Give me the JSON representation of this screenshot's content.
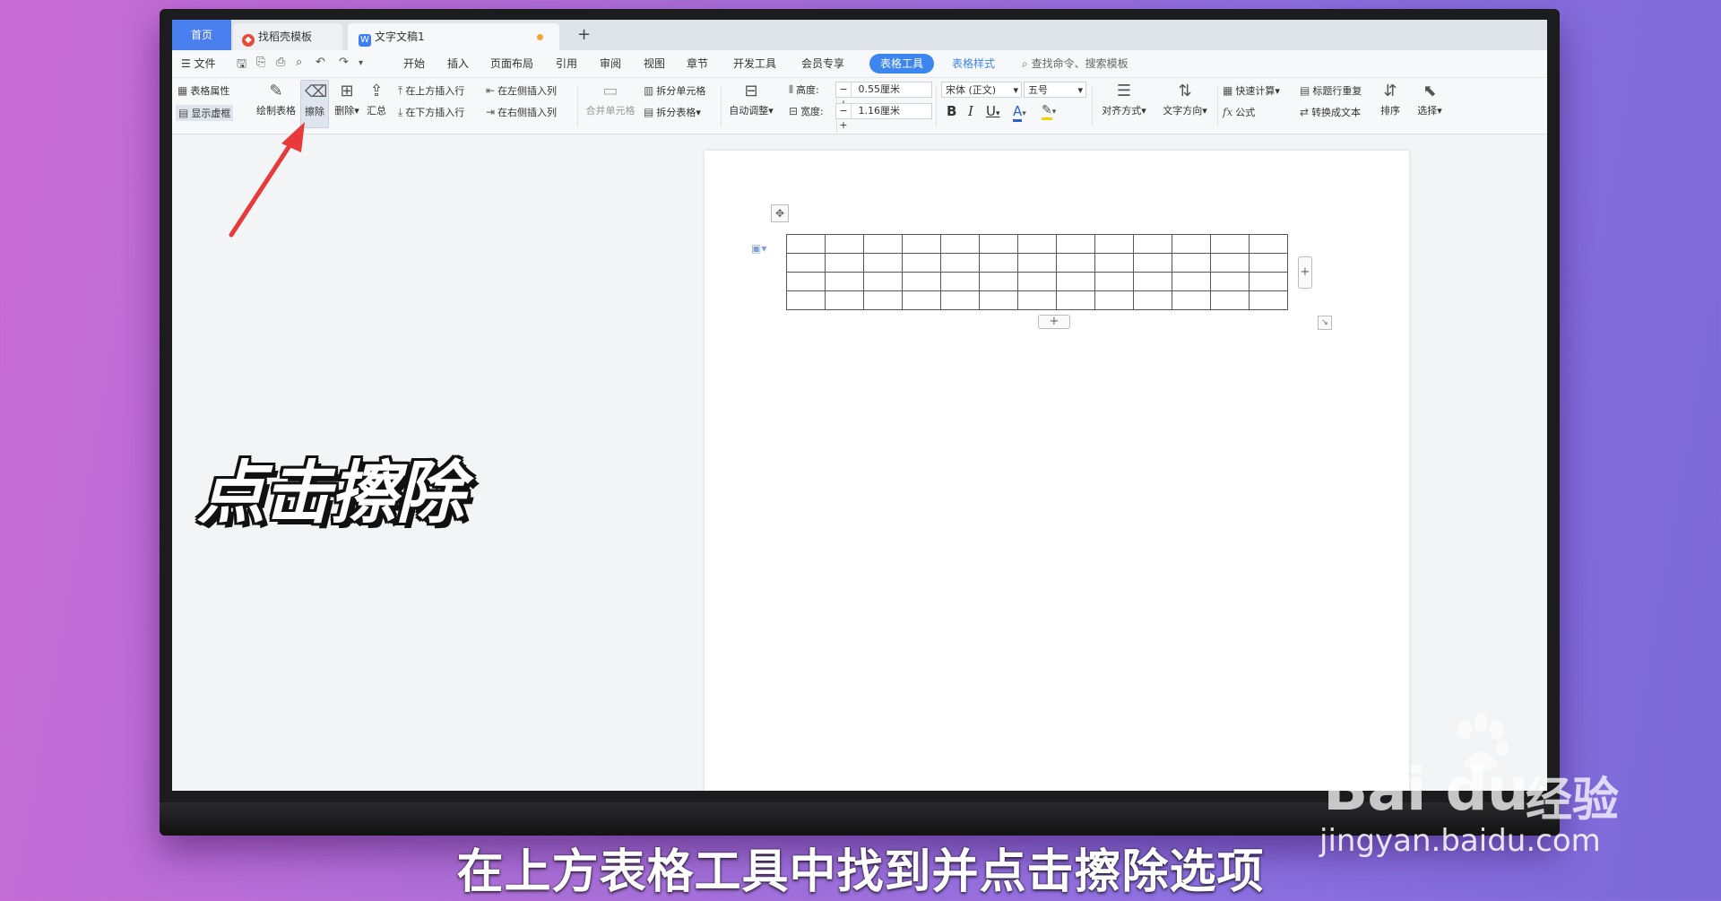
{
  "tabs": {
    "home": "首页",
    "template": "找稻壳模板",
    "document": "文字文稿1",
    "new_tab": "+"
  },
  "menu": {
    "file": "文件",
    "items": [
      "开始",
      "插入",
      "页面布局",
      "引用",
      "审阅",
      "视图",
      "章节",
      "开发工具",
      "会员专享"
    ],
    "active": "表格工具",
    "style": "表格样式",
    "search": "查找命令、搜索模板"
  },
  "ribbon": {
    "table_props": "表格属性",
    "show_grid": "显示虚框",
    "draw_table": "绘制表格",
    "erase": "擦除",
    "delete": "删除",
    "summary": "汇总",
    "insert_row_above": "在上方插入行",
    "insert_row_below": "在下方插入行",
    "insert_col_left": "在左侧插入列",
    "insert_col_right": "在右侧插入列",
    "merge_cells": "合并单元格",
    "split_cells": "拆分单元格",
    "split_table": "拆分表格",
    "auto_fit": "自动调整",
    "height_label": "高度:",
    "height_value": "0.55厘米",
    "width_label": "宽度:",
    "width_value": "1.16厘米",
    "font_name": "宋体 (正文)",
    "font_size": "五号",
    "bold": "B",
    "italic": "I",
    "underline": "U",
    "font_color": "A",
    "align": "对齐方式",
    "text_dir": "文字方向",
    "quick_calc": "快速计算",
    "formula": "公式",
    "repeat_header": "标题行重复",
    "to_text": "转换成文本",
    "sort": "排序",
    "select": "选择"
  },
  "table": {
    "rows": 4,
    "cols": 13
  },
  "overlay": {
    "callout": "点击擦除",
    "subtitle": "在上方表格工具中找到并点击擦除选项"
  },
  "watermark": {
    "logo": "Bai du",
    "cn": "经验",
    "url": "jingyan.baidu.com"
  },
  "colors": {
    "accent": "#3d86f0",
    "arrow": "#e83a3a"
  }
}
